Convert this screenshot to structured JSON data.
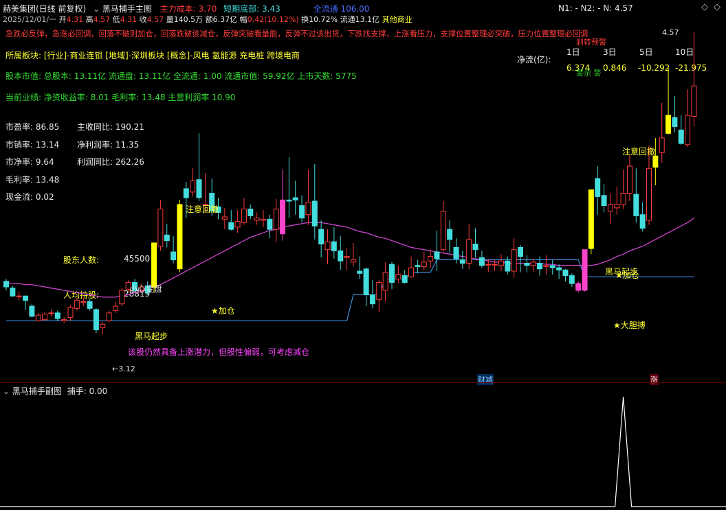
{
  "header": {
    "stock": "赫美集团(日线 前复权)",
    "indicator": "黑马捕手主图",
    "main_cost_label": "主力成本:",
    "main_cost_value": "3.70",
    "short_bottom_label": "短期底部:",
    "short_bottom_value": "3.43",
    "full_flow_label": "全流通",
    "full_flow_value": "106.00",
    "n_readout": "N1: -  N2: -  N: 4.57"
  },
  "quote": {
    "date": "2025/12/01/一",
    "open_label": "开",
    "open": "4.31",
    "high_label": "高",
    "high": "4.57",
    "low_label": "低",
    "low": "4.31",
    "close_label": "收",
    "close": "4.57",
    "vol_label": "量",
    "vol": "140.5万",
    "amt_label": "额",
    "amt": "6.37亿",
    "range_label": "幅",
    "range": "0.42(10.12%)",
    "turn_label": "换",
    "turn": "10.72%",
    "float_label": "流通",
    "float": "13.1亿",
    "industry": "其他商业"
  },
  "advice_text": "急跌必反弹，急涨必回调，回落不破则加仓，回落跌破该减仓，反弹突破看量能，反弹不过该出货，下跌找支撑，上涨看压力，支撑位置整理必突破，压力位置整理必回调",
  "info": {
    "sector": "所属板块: [行业]-商业连锁 [地域]-深圳板块 [概念]-风电 氢能源 充电桩 跨境电商",
    "market": "股本市值: 总股本: 13.11亿 流通盘: 13.11亿 全流通: 1.00 流通市值: 59.92亿 上市天数: 5775",
    "perf": "当前业绩: 净资收益率: 8.01 毛利率: 13.48 主营利润率 10.90"
  },
  "ratios_left": [
    {
      "label": "市盈率:",
      "value": "86.85"
    },
    {
      "label": "市销率:",
      "value": "13.14"
    },
    {
      "label": "市净率:",
      "value": "9.64"
    },
    {
      "label": "毛利率:",
      "value": "13.48"
    },
    {
      "label": "现金流:",
      "value": "0.02"
    }
  ],
  "ratios_right": [
    {
      "label": "主收同比:",
      "value": "190.21"
    },
    {
      "label": "净利润率:",
      "value": "11.35"
    },
    {
      "label": "利润同比:",
      "value": "262.26"
    }
  ],
  "holders": {
    "label1": "股东人数:",
    "value1": "45500",
    "label2": "人均持股:",
    "value2": "28819"
  },
  "netflow": {
    "label": "净流(亿):",
    "periods": [
      "1日",
      "3日",
      "5日",
      "10日"
    ],
    "values": [
      "6.374",
      "0.846",
      "-10.292",
      "-21.975"
    ],
    "note": "警示 警",
    "warn": "刹转预警"
  },
  "chart_labels": {
    "top_price": "4.57",
    "low_price": "3.12",
    "signal_attention1": "注意回撤",
    "signal_attention2": "注意回撤",
    "signal_add1": "★加仓",
    "signal_add2": "★加仓",
    "signal_bold": "★大胆搏",
    "signal_horse1": "黑马起步",
    "signal_horse2": "黑马起步",
    "signal_small": "小心变盘",
    "comment": "该股仍然具备上涨潜力，但股性偏弱，可考虑减仓",
    "badge_finance": "财减",
    "badge_rise": "涨"
  },
  "sub_panel": {
    "title": "黑马捕手副图",
    "value_label": "捕手: 0.00"
  },
  "colors": {
    "up": "#ff3c3c",
    "down": "#44dddd",
    "yellow": "#ffff00",
    "magenta": "#ff44cc",
    "ma": "#cc44cc",
    "support": "#4aa8ff"
  },
  "candles": [
    [
      3.84,
      3.79,
      3.86,
      3.76
    ],
    [
      3.78,
      3.71,
      3.8,
      3.7
    ],
    [
      3.71,
      3.71,
      3.75,
      3.67
    ],
    [
      3.71,
      3.67,
      3.71,
      3.59
    ],
    [
      3.62,
      3.53,
      3.64,
      3.52
    ],
    [
      3.49,
      3.54,
      3.56,
      3.48
    ],
    [
      3.5,
      3.55,
      3.57,
      3.49
    ],
    [
      3.56,
      3.56,
      3.59,
      3.53
    ],
    [
      3.56,
      3.51,
      3.58,
      3.49
    ],
    [
      3.49,
      3.5,
      3.52,
      3.47
    ],
    [
      3.52,
      3.61,
      3.63,
      3.49
    ],
    [
      3.6,
      3.67,
      3.69,
      3.58
    ],
    [
      3.66,
      3.66,
      3.7,
      3.62
    ],
    [
      3.66,
      3.6,
      3.68,
      3.58
    ],
    [
      3.59,
      3.41,
      3.6,
      3.38
    ],
    [
      3.43,
      3.46,
      3.48,
      3.37
    ],
    [
      3.49,
      3.56,
      3.58,
      3.47
    ],
    [
      3.58,
      3.62,
      3.66,
      3.56
    ],
    [
      3.64,
      3.76,
      3.78,
      3.62
    ],
    [
      3.77,
      3.83,
      3.85,
      3.74
    ],
    [
      3.83,
      3.76,
      3.86,
      3.74
    ],
    [
      3.76,
      3.79,
      3.82,
      3.74
    ],
    [
      3.8,
      3.74,
      3.84,
      3.72
    ],
    [
      3.79,
      4.18,
      4.18,
      3.74
    ],
    [
      4.15,
      4.48,
      4.56,
      4.11
    ],
    [
      4.25,
      4.2,
      4.35,
      4.14
    ],
    [
      4.1,
      4.03,
      4.24,
      4.0
    ],
    [
      3.95,
      4.52,
      4.56,
      3.92
    ],
    [
      4.66,
      4.58,
      4.72,
      4.4
    ],
    [
      4.63,
      4.73,
      4.84,
      4.59
    ],
    [
      4.74,
      4.58,
      5.15,
      4.55
    ],
    [
      4.52,
      4.52,
      4.8,
      4.45
    ],
    [
      4.62,
      4.46,
      4.75,
      4.42
    ],
    [
      4.5,
      4.45,
      4.58,
      4.39
    ],
    [
      4.39,
      4.41,
      4.49,
      4.3
    ],
    [
      4.36,
      4.3,
      4.47,
      4.29
    ],
    [
      4.32,
      4.37,
      4.47,
      4.27
    ],
    [
      4.36,
      4.48,
      4.58,
      4.34
    ],
    [
      4.48,
      4.42,
      4.52,
      4.39
    ],
    [
      4.38,
      4.4,
      4.45,
      4.34
    ],
    [
      4.38,
      4.39,
      4.47,
      4.32
    ],
    [
      4.39,
      4.3,
      4.43,
      4.22
    ],
    [
      4.3,
      4.48,
      4.57,
      4.19
    ],
    [
      4.56,
      4.26,
      4.83,
      4.2
    ],
    [
      4.56,
      4.55,
      4.94,
      4.4
    ],
    [
      4.58,
      4.56,
      4.73,
      4.43
    ],
    [
      4.51,
      4.4,
      4.6,
      4.36
    ],
    [
      4.43,
      4.54,
      4.83,
      4.34
    ],
    [
      4.55,
      4.33,
      4.88,
      4.21
    ],
    [
      4.3,
      4.17,
      4.38,
      4.05
    ],
    [
      4.12,
      4.19,
      4.3,
      3.99
    ],
    [
      4.19,
      4.11,
      4.32,
      4.04
    ],
    [
      4.11,
      4.02,
      4.24,
      3.94
    ],
    [
      4.05,
      4.06,
      4.13,
      3.94
    ],
    [
      4.01,
      4.03,
      4.18,
      3.97
    ],
    [
      3.93,
      3.91,
      4.06,
      3.86
    ],
    [
      3.95,
      3.72,
      3.96,
      3.62
    ],
    [
      3.72,
      3.64,
      3.85,
      3.6
    ],
    [
      3.68,
      3.83,
      3.85,
      3.57
    ],
    [
      3.76,
      3.92,
      4.01,
      3.66
    ],
    [
      3.99,
      3.83,
      4.01,
      3.77
    ],
    [
      3.86,
      3.9,
      3.98,
      3.82
    ],
    [
      3.89,
      3.83,
      3.94,
      3.82
    ],
    [
      3.88,
      3.96,
      4.06,
      3.87
    ],
    [
      3.98,
      3.97,
      4.03,
      3.91
    ],
    [
      3.97,
      4.01,
      4.1,
      3.94
    ],
    [
      4.02,
      4.06,
      4.12,
      3.96
    ],
    [
      4.1,
      4.04,
      4.29,
      3.93
    ],
    [
      4.12,
      4.46,
      4.55,
      4.1
    ],
    [
      4.3,
      4.21,
      4.38,
      4.09
    ],
    [
      4.14,
      4.04,
      4.22,
      4.0
    ],
    [
      4.03,
      4.0,
      4.11,
      3.95
    ],
    [
      4.0,
      4.21,
      4.35,
      3.95
    ],
    [
      4.17,
      4.12,
      4.31,
      4.05
    ],
    [
      4.05,
      3.98,
      4.11,
      3.96
    ],
    [
      3.99,
      3.99,
      4.04,
      3.92
    ],
    [
      3.99,
      3.99,
      4.03,
      3.93
    ],
    [
      3.98,
      4.02,
      4.08,
      3.93
    ],
    [
      4.02,
      3.93,
      4.06,
      3.9
    ],
    [
      3.93,
      4.12,
      4.22,
      3.87
    ],
    [
      4.14,
      4.06,
      4.16,
      3.92
    ],
    [
      4.0,
      3.98,
      4.07,
      3.92
    ],
    [
      3.98,
      4.01,
      4.04,
      3.92
    ],
    [
      4.0,
      3.95,
      4.06,
      3.89
    ],
    [
      3.97,
      3.98,
      4.07,
      3.9
    ],
    [
      3.98,
      3.96,
      4.03,
      3.9
    ],
    [
      3.96,
      3.94,
      3.99,
      3.86
    ],
    [
      3.94,
      3.89,
      3.95,
      3.84
    ],
    [
      3.89,
      3.82,
      3.91,
      3.79
    ],
    [
      3.82,
      3.76,
      3.84,
      3.74
    ],
    [
      3.76,
      4.12,
      4.12,
      3.75
    ],
    [
      4.13,
      4.65,
      4.65,
      4.08
    ],
    [
      4.75,
      4.59,
      4.86,
      4.43
    ],
    [
      4.6,
      4.51,
      4.7,
      4.45
    ],
    [
      4.46,
      4.52,
      4.62,
      4.35
    ],
    [
      4.49,
      4.52,
      4.68,
      4.43
    ],
    [
      4.52,
      4.62,
      4.83,
      4.48
    ],
    [
      4.62,
      4.86,
      4.96,
      4.55
    ],
    [
      4.61,
      4.42,
      4.84,
      4.36
    ],
    [
      4.43,
      4.31,
      4.54,
      4.28
    ],
    [
      4.38,
      4.84,
      5.04,
      4.34
    ],
    [
      4.85,
      4.95,
      5.11,
      4.69
    ],
    [
      4.98,
      5.11,
      5.42,
      4.89
    ],
    [
      5.15,
      5.31,
      5.73,
      5.14
    ],
    [
      5.29,
      5.21,
      5.48,
      5.16
    ],
    [
      5.18,
      5.06,
      5.31,
      5.05
    ],
    [
      5.05,
      5.31,
      5.54,
      5.03
    ],
    [
      5.3,
      5.57,
      6.05,
      5.21
    ]
  ],
  "ma": [
    3.83,
    3.82,
    3.82,
    3.81,
    3.81,
    3.8,
    3.79,
    3.78,
    3.77,
    3.76,
    3.75,
    3.74,
    3.73,
    3.72,
    3.71,
    3.7,
    3.7,
    3.7,
    3.71,
    3.72,
    3.74,
    3.75,
    3.77,
    3.79,
    3.81,
    3.84,
    3.87,
    3.9,
    3.93,
    3.96,
    3.99,
    4.02,
    4.05,
    4.08,
    4.11,
    4.14,
    4.17,
    4.2,
    4.23,
    4.25,
    4.27,
    4.29,
    4.3,
    4.32,
    4.33,
    4.34,
    4.35,
    4.36,
    4.36,
    4.36,
    4.35,
    4.34,
    4.33,
    4.32,
    4.3,
    4.28,
    4.27,
    4.25,
    4.23,
    4.22,
    4.2,
    4.18,
    4.16,
    4.14,
    4.13,
    4.12,
    4.11,
    4.1,
    4.09,
    4.08,
    4.07,
    4.06,
    4.05,
    4.04,
    4.03,
    4.02,
    4.01,
    4.01,
    4.0,
    4.0,
    4.0,
    4.0,
    4.0,
    4.0,
    3.99,
    3.99,
    3.98,
    3.98,
    3.98,
    3.98,
    3.98,
    3.98,
    3.99,
    4.01,
    4.03,
    4.06,
    4.08,
    4.11,
    4.13,
    4.15,
    4.18,
    4.21,
    4.24,
    4.27,
    4.3,
    4.33,
    4.36,
    4.4
  ],
  "support": [
    3.49,
    3.49,
    3.49,
    3.49,
    3.49,
    3.49,
    3.49,
    3.49,
    3.49,
    3.49,
    3.49,
    3.49,
    3.49,
    3.49,
    3.49,
    3.49,
    3.49,
    3.49,
    3.49,
    3.49,
    3.49,
    3.49,
    3.49,
    3.49,
    3.49,
    3.49,
    3.49,
    3.49,
    3.49,
    3.49,
    3.49,
    3.49,
    3.49,
    3.49,
    3.49,
    3.49,
    3.49,
    3.49,
    3.49,
    3.49,
    3.49,
    3.49,
    3.49,
    3.49,
    3.49,
    3.49,
    3.49,
    3.49,
    3.49,
    3.49,
    3.49,
    3.49,
    3.49,
    3.49,
    3.72,
    3.72,
    3.72,
    3.72,
    3.72,
    3.86,
    3.86,
    3.86,
    3.86,
    3.92,
    3.92,
    3.92,
    3.92,
    4.03,
    4.03,
    4.03,
    4.03,
    4.03,
    4.03,
    4.03,
    4.03,
    4.03,
    4.03,
    4.03,
    4.03,
    4.03,
    4.03,
    4.03,
    4.03,
    4.03,
    4.03,
    4.03,
    4.03,
    4.03,
    4.03,
    4.03,
    3.88,
    3.88,
    3.88,
    3.88,
    3.88,
    3.88,
    3.88,
    3.88,
    3.88,
    3.88,
    3.88,
    3.88,
    3.88,
    3.88,
    3.88,
    3.88,
    3.88,
    3.88
  ],
  "yellow_idx": [
    23,
    27,
    91,
    101,
    103
  ],
  "magenta_idx": [
    43,
    89,
    90
  ],
  "sub_signal": {
    "index": 96,
    "value": 1
  }
}
